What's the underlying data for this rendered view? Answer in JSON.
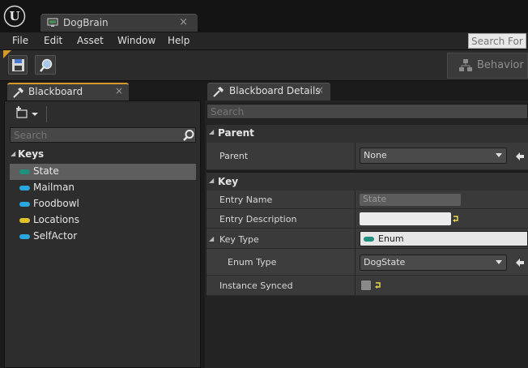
{
  "document_tab": {
    "label": "DogBrain",
    "close": "×"
  },
  "menu": {
    "items": [
      "File",
      "Edit",
      "Asset",
      "Window",
      "Help"
    ],
    "search_placeholder": "Search For"
  },
  "toolbar": {
    "behavior_label": "Behavior"
  },
  "blackboard": {
    "tab_label": "Blackboard",
    "tab_close": "×",
    "search_placeholder": "Search",
    "keys_label": "Keys",
    "keys": [
      {
        "label": "State",
        "color": "#1f8f7e",
        "selected": true
      },
      {
        "label": "Mailman",
        "color": "#2aa6e0",
        "selected": false
      },
      {
        "label": "Foodbowl",
        "color": "#2aa6e0",
        "selected": false
      },
      {
        "label": "Locations",
        "color": "#e0c12a",
        "selected": false
      },
      {
        "label": "SelfActor",
        "color": "#2aa6e0",
        "selected": false
      }
    ]
  },
  "details": {
    "tab_label": "Blackboard Details",
    "tab_close": "×",
    "search_placeholder": "Search",
    "parent_section": {
      "title": "Parent",
      "prop_label": "Parent",
      "value": "None"
    },
    "key_section": {
      "title": "Key",
      "entry_name_label": "Entry Name",
      "entry_name_value": "State",
      "entry_description_label": "Entry Description",
      "entry_description_value": "",
      "key_type_label": "Key Type",
      "key_type_value": "Enum",
      "enum_type_label": "Enum Type",
      "enum_type_value": "DogState",
      "instance_synced_label": "Instance Synced",
      "instance_synced_checked": false
    }
  },
  "colors": {
    "accent_tab": "#d59a2a",
    "enum_pill": "#1f8f7e",
    "reset_yellow": "#e6d84a"
  }
}
